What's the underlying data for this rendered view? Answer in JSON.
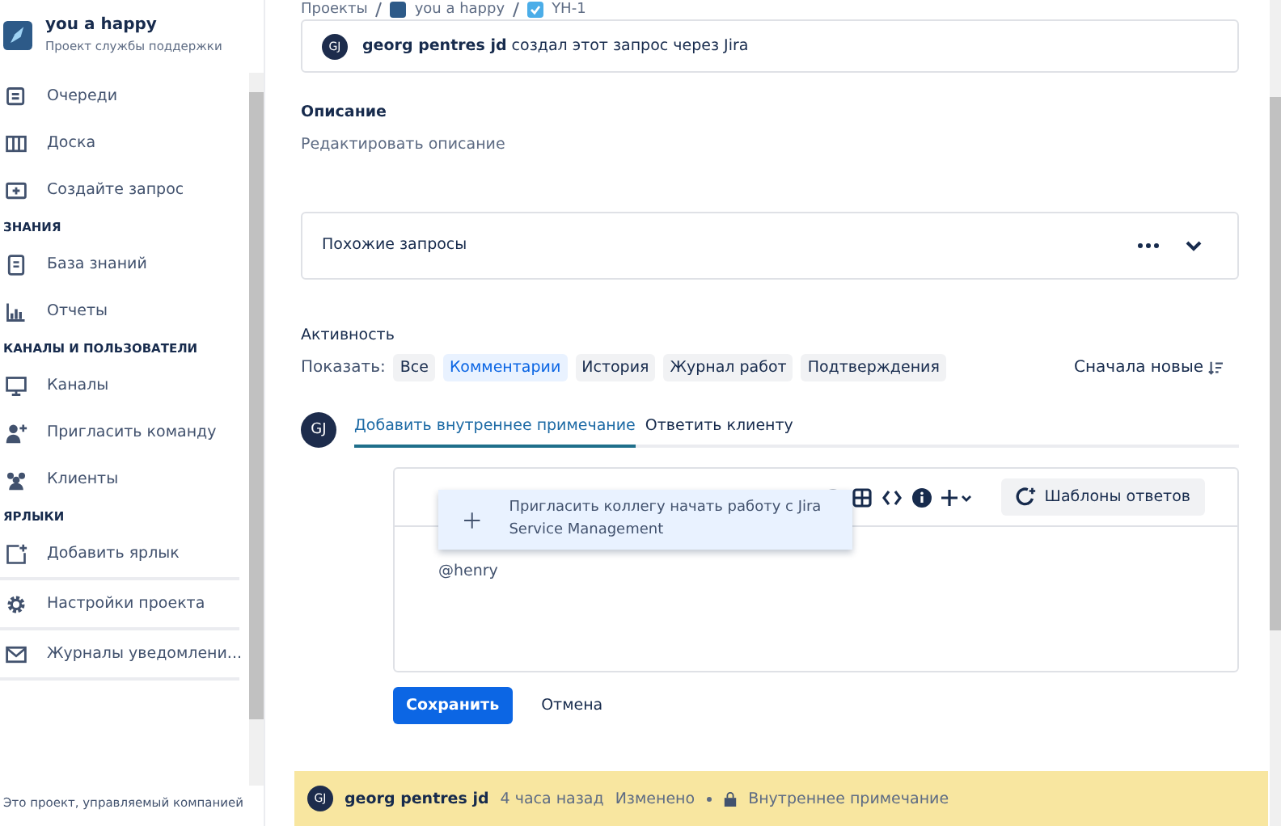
{
  "sidebar": {
    "project": {
      "name": "you a happy",
      "subtitle": "Проект службы поддержки"
    },
    "groups": [
      {
        "items": [
          {
            "label": "Очереди"
          },
          {
            "label": "Доска"
          },
          {
            "label": "Создайте запрос"
          }
        ]
      },
      {
        "title": "ЗНАНИЯ",
        "items": [
          {
            "label": "База знаний"
          },
          {
            "label": "Отчеты"
          }
        ]
      },
      {
        "title": "КАНАЛЫ И ПОЛЬЗОВАТЕЛИ",
        "items": [
          {
            "label": "Каналы"
          },
          {
            "label": "Пригласить команду"
          },
          {
            "label": "Клиенты"
          }
        ]
      },
      {
        "title": "ЯРЛЫКИ",
        "items": [
          {
            "label": "Добавить ярлык"
          }
        ]
      }
    ],
    "footer_items": [
      {
        "label": "Настройки проекта"
      },
      {
        "label": "Журналы уведомлени..."
      }
    ],
    "note": "Это проект, управляемый компанией"
  },
  "breadcrumbs": [
    "Проекты",
    "you a happy",
    "YH-1"
  ],
  "created_note": {
    "avatar": "GJ",
    "author": "georg pentres jd",
    "text": "создал этот запрос через Jira"
  },
  "description": {
    "title": "Описание",
    "placeholder": "Редактировать описание"
  },
  "similar": {
    "title": "Похожие запросы",
    "expanded": false
  },
  "activity": {
    "title": "Активность",
    "show_label": "Показать:",
    "filters": [
      {
        "label": "Все",
        "selected": false
      },
      {
        "label": "Комментарии",
        "selected": true
      },
      {
        "label": "История",
        "selected": false
      },
      {
        "label": "Журнал работ",
        "selected": false
      },
      {
        "label": "Подтверждения",
        "selected": false
      }
    ],
    "sort": "Сначала новые"
  },
  "composer": {
    "avatar": "GJ",
    "tabs": [
      {
        "label": "Добавить внутреннее примечание",
        "selected": true
      },
      {
        "label": "Ответить клиенту",
        "selected": false
      }
    ],
    "templates_button": "Шаблоны ответов",
    "value": "@henry",
    "suggestion": "Пригласить коллегу начать работу с Jira Service Management",
    "save": "Сохранить",
    "cancel": "Отмена"
  },
  "comment": {
    "avatar": "GJ",
    "author": "georg pentres jd",
    "time": "4 часа назад",
    "edited": "Изменено",
    "visibility": "Внутреннее примечание"
  }
}
